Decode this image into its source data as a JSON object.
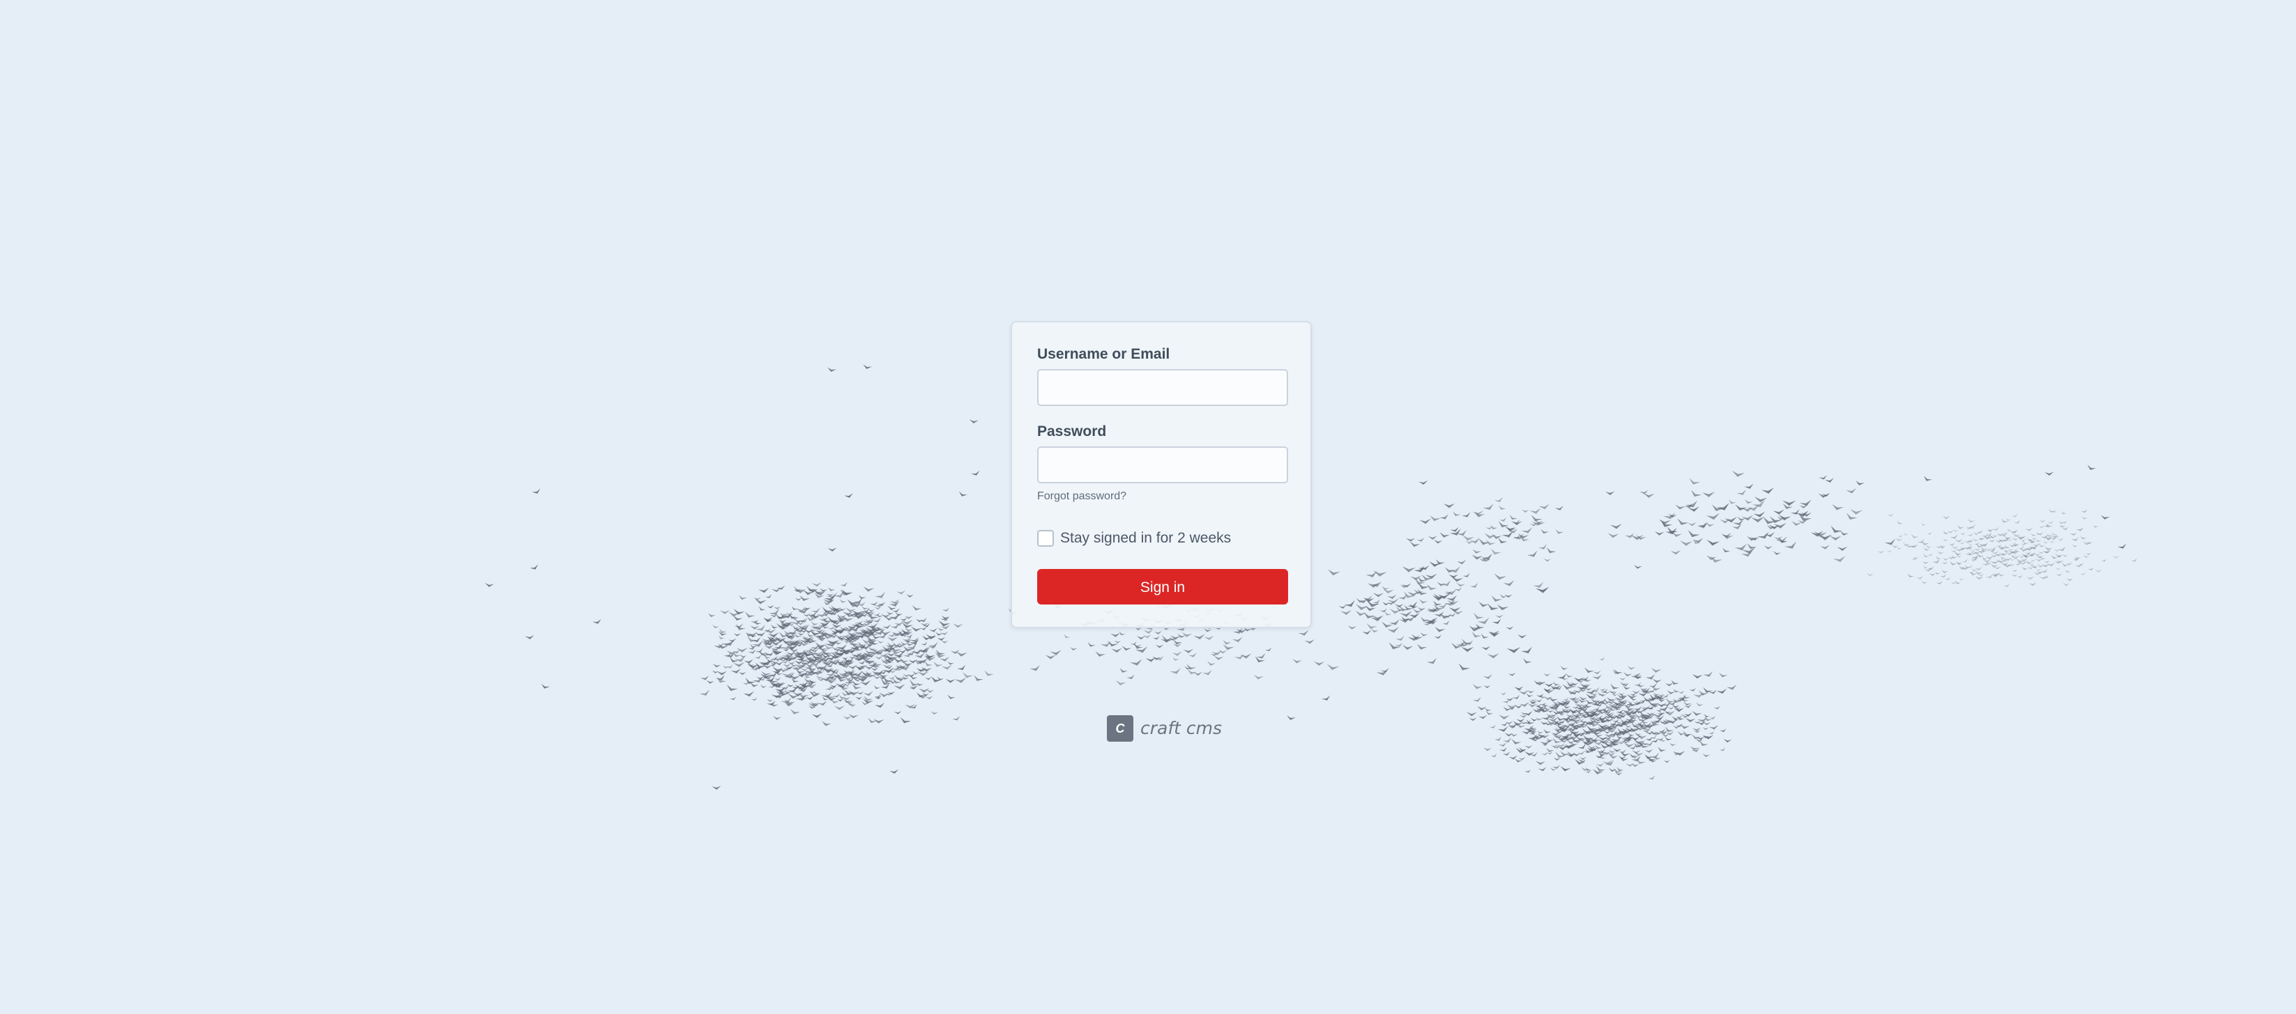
{
  "login": {
    "username_label": "Username or Email",
    "username_value": "",
    "password_label": "Password",
    "password_value": "",
    "forgot_link": "Forgot password?",
    "remember_label": "Stay signed in for 2 weeks",
    "remember_checked": false,
    "submit_label": "Sign in"
  },
  "brand": {
    "mark": "C",
    "name": "craft cms"
  },
  "icons": [
    "craft-cms-logo-icon",
    "bird-flock-illustration"
  ],
  "colors": {
    "background": "#e5edf6",
    "accent": "#dc2626",
    "birds": "#5b6573",
    "brand_gray": "#6b7581"
  }
}
